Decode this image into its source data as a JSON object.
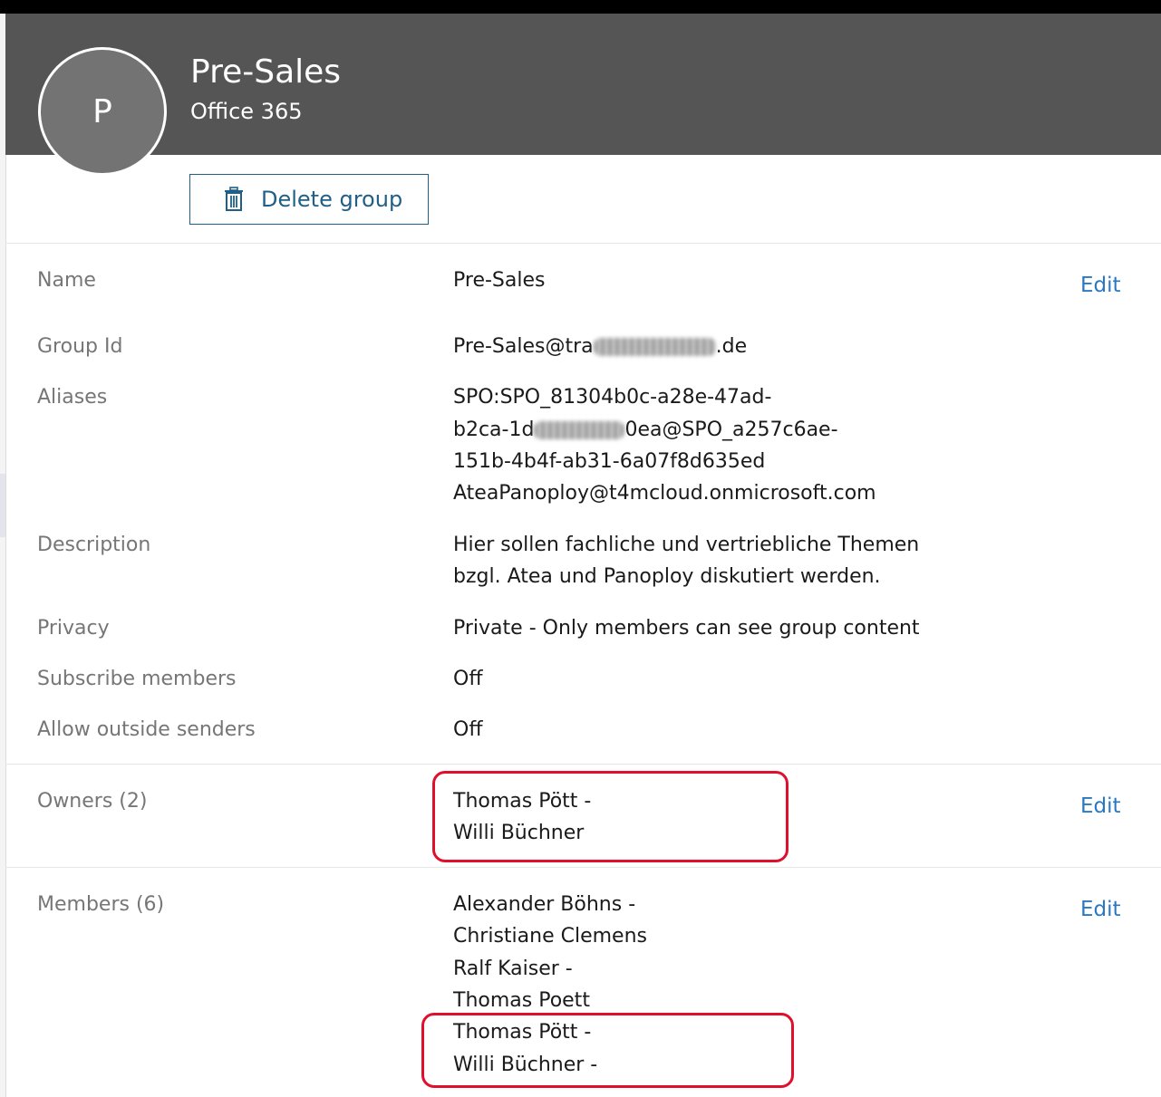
{
  "group": {
    "avatar_initial": "P",
    "title": "Pre-Sales",
    "subtitle": "Office 365",
    "delete_label": "Delete group"
  },
  "properties": {
    "name_label": "Name",
    "name_value": "Pre-Sales",
    "edit_label": "Edit",
    "groupid_label": "Group Id",
    "groupid_prefix": "Pre-Sales@tra",
    "groupid_suffix": ".de",
    "aliases_label": "Aliases",
    "aliases_line1": "SPO:SPO_81304b0c-a28e-47ad-",
    "aliases_line2_prefix": "b2ca-1d",
    "aliases_line2_suffix": "0ea@SPO_a257c6ae-",
    "aliases_line3": "151b-4b4f-ab31-6a07f8d635ed",
    "aliases_line4": "AteaPanoploy@t4mcloud.onmicrosoft.com",
    "description_label": "Description",
    "description_line1": "Hier sollen fachliche und vertriebliche Themen",
    "description_line2": "bzgl. Atea und Panoploy diskutiert werden.",
    "privacy_label": "Privacy",
    "privacy_value": "Private - Only members can see group content",
    "subscribe_label": "Subscribe members",
    "subscribe_value": "Off",
    "outside_label": "Allow outside senders",
    "outside_value": "Off"
  },
  "owners": {
    "label": "Owners (2)",
    "items": [
      "Thomas Pött -",
      "Willi Büchner"
    ],
    "edit_label": "Edit"
  },
  "members": {
    "label": "Members (6)",
    "items": [
      "Alexander Böhns -",
      "Christiane Clemens",
      "Ralf Kaiser -",
      "Thomas Poett",
      "Thomas Pött -",
      "Willi Büchner -"
    ],
    "edit_label": "Edit"
  },
  "colors": {
    "header_bg": "#555555",
    "accent_blue": "#2b78c2",
    "annotation_red": "#e0102c"
  }
}
